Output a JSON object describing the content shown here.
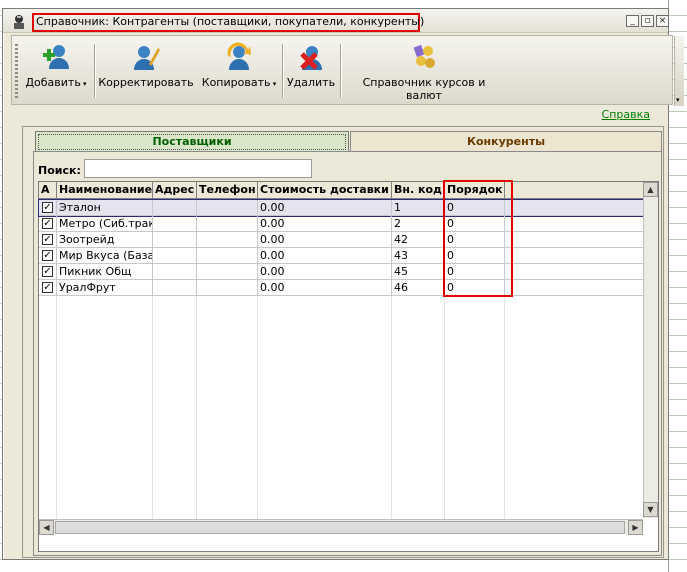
{
  "window": {
    "title": "Справочник: Контрагенты (поставщики, покупатели, конкуренты)",
    "min_icon": "minimize-icon",
    "restore_icon": "restore-icon",
    "close_icon": "close-icon"
  },
  "toolbar": {
    "add_label": "Добавить",
    "edit_label": "Корректировать",
    "copy_label": "Копировать",
    "delete_label": "Удалить",
    "rates_label": "Справочник курсов и валют"
  },
  "help_link": "Справка",
  "tabs": [
    {
      "label": "Поставщики",
      "active": true
    },
    {
      "label": "Конкуренты",
      "active": false
    }
  ],
  "search": {
    "label": "Поиск:",
    "value": ""
  },
  "grid": {
    "columns": [
      "А",
      "Наименование",
      "Адрес",
      "Телефон",
      "Стоимость доставки",
      "Вн. код",
      "Порядок"
    ],
    "rows": [
      {
        "active": true,
        "name": "Эталон",
        "address": "",
        "phone": "",
        "delivery": "0.00",
        "code": "1",
        "order": "0"
      },
      {
        "active": true,
        "name": "Метро (Сиб.тракт)",
        "address": "",
        "phone": "",
        "delivery": "0.00",
        "code": "2",
        "order": "0"
      },
      {
        "active": true,
        "name": "Зоотрейд",
        "address": "",
        "phone": "",
        "delivery": "0.00",
        "code": "42",
        "order": "0"
      },
      {
        "active": true,
        "name": "Мир Вкуса (База)",
        "address": "",
        "phone": "",
        "delivery": "0.00",
        "code": "43",
        "order": "0"
      },
      {
        "active": true,
        "name": "Пикник Общ",
        "address": "",
        "phone": "",
        "delivery": "0.00",
        "code": "45",
        "order": "0"
      },
      {
        "active": true,
        "name": "УралФрут",
        "address": "",
        "phone": "",
        "delivery": "0.00",
        "code": "46",
        "order": "0"
      }
    ]
  },
  "colors": {
    "highlight": "#e00000",
    "active_tab": "#006000",
    "inactive_tab": "#6b3a00",
    "link": "#008000"
  }
}
